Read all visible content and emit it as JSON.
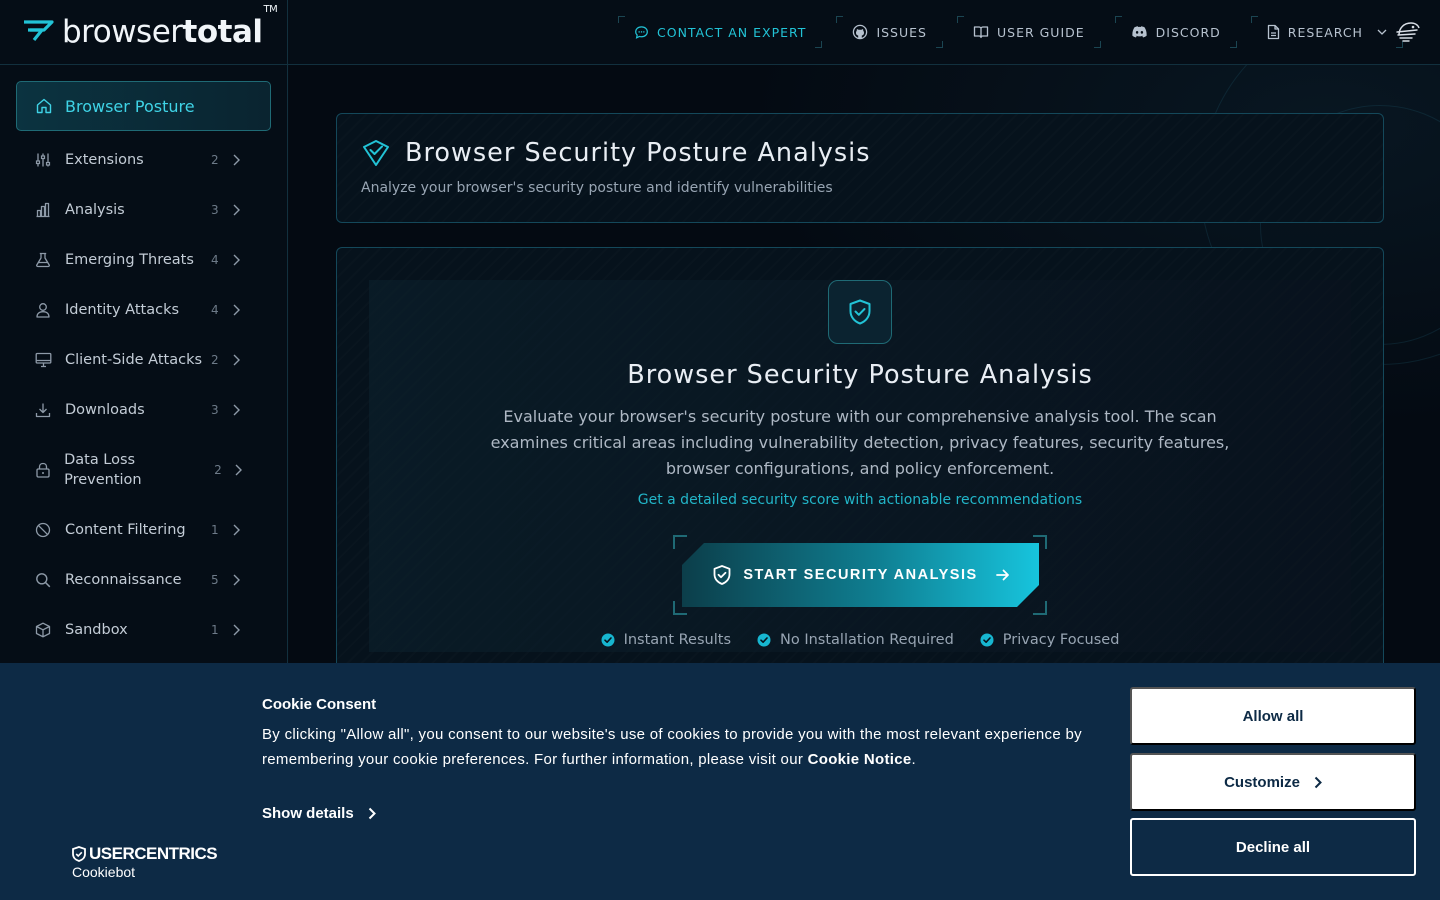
{
  "brand": {
    "name_light": "browser",
    "name_bold": "total",
    "tm": "TM"
  },
  "topnav": {
    "items": [
      {
        "label": "CONTACT AN EXPERT",
        "icon": "chat-bubble-icon"
      },
      {
        "label": "ISSUES",
        "icon": "github-icon"
      },
      {
        "label": "USER GUIDE",
        "icon": "book-icon"
      },
      {
        "label": "DISCORD",
        "icon": "discord-icon"
      },
      {
        "label": "RESEARCH",
        "icon": "document-icon"
      }
    ],
    "accent_color": "#22c3d6"
  },
  "sidebar": {
    "active": {
      "label": "Browser Posture",
      "icon": "home-icon"
    },
    "items": [
      {
        "label": "Extensions",
        "count": "2",
        "icon": "sliders-icon"
      },
      {
        "label": "Analysis",
        "count": "3",
        "icon": "bar-chart-icon"
      },
      {
        "label": "Emerging Threats",
        "count": "4",
        "icon": "flask-icon"
      },
      {
        "label": "Identity Attacks",
        "count": "4",
        "icon": "user-icon"
      },
      {
        "label": "Client-Side Attacks",
        "count": "2",
        "icon": "monitor-icon"
      },
      {
        "label": "Downloads",
        "count": "3",
        "icon": "download-icon"
      },
      {
        "label": "Data Loss Prevention",
        "count": "2",
        "icon": "lock-icon"
      },
      {
        "label": "Content Filtering",
        "count": "1",
        "icon": "ban-icon"
      },
      {
        "label": "Reconnaissance",
        "count": "5",
        "icon": "search-icon"
      },
      {
        "label": "Sandbox",
        "count": "1",
        "icon": "box-icon"
      }
    ]
  },
  "header_card": {
    "title": "Browser Security Posture Analysis",
    "subtitle": "Analyze your browser's security posture and identify vulnerabilities"
  },
  "main_card": {
    "title": "Browser Security Posture Analysis",
    "description": "Evaluate your browser's security posture with our comprehensive analysis tool. The scan examines critical areas including vulnerability detection, privacy features, security features, browser configurations, and policy enforcement.",
    "link": "Get a detailed security score with actionable recommendations",
    "cta_label": "START SECURITY ANALYSIS",
    "features": [
      "Instant Results",
      "No Installation Required",
      "Privacy Focused"
    ]
  },
  "cookie": {
    "title": "Cookie Consent",
    "body_before": "By clicking \"Allow all\", you consent to our website's use of cookies to provide you with the most relevant experience by remembering your cookie preferences. For further information, please visit our ",
    "body_link": "Cookie Notice",
    "body_after": ".",
    "show_details": "Show details",
    "allow_all": "Allow all",
    "customize": "Customize",
    "decline_all": "Decline all",
    "logo_top": "USERCENTRICS",
    "logo_bottom": "Cookiebot",
    "background": "#0d2a45"
  }
}
